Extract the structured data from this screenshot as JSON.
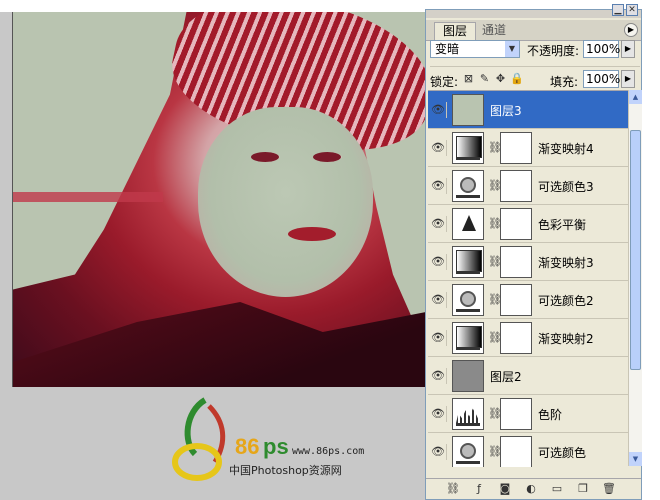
{
  "canvas": {
    "watermark": {
      "brand": "86",
      "brand_suffix": "ps",
      "site": "www.86ps.com",
      "name": "中国Photoshop资源网"
    }
  },
  "panel": {
    "tabs": [
      {
        "label": "图层",
        "active": true
      },
      {
        "label": "通道",
        "active": false
      }
    ],
    "blend_mode": "变暗",
    "opacity_label": "不透明度:",
    "opacity_value": "100%",
    "lock_label": "锁定:",
    "fill_label": "填充:",
    "fill_value": "100%",
    "layers": [
      {
        "name": "图层3",
        "type": "pixel",
        "selected": true
      },
      {
        "name": "渐变映射4",
        "type": "gradient-map",
        "selected": false
      },
      {
        "name": "可选颜色3",
        "type": "selective-color",
        "selected": false
      },
      {
        "name": "色彩平衡",
        "type": "color-balance",
        "selected": false
      },
      {
        "name": "渐变映射3",
        "type": "gradient-map",
        "selected": false
      },
      {
        "name": "可选颜色2",
        "type": "selective-color",
        "selected": false
      },
      {
        "name": "渐变映射2",
        "type": "gradient-map",
        "selected": false
      },
      {
        "name": "图层2",
        "type": "pixel",
        "selected": false
      },
      {
        "name": "色阶",
        "type": "levels",
        "selected": false
      },
      {
        "name": "可选颜色",
        "type": "selective-color",
        "selected": false
      }
    ],
    "selection_color": "#316ac5"
  }
}
